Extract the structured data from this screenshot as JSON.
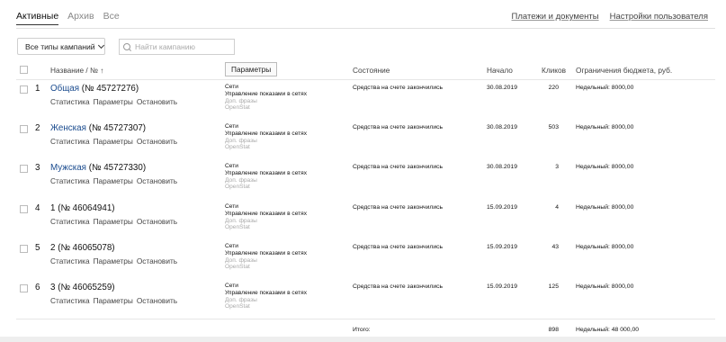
{
  "tabs": [
    {
      "label": "Активные",
      "active": true
    },
    {
      "label": "Архив",
      "active": false
    },
    {
      "label": "Все",
      "active": false
    }
  ],
  "top_links": {
    "payments": "Платежи и документы",
    "settings": "Настройки пользователя"
  },
  "filter": {
    "campaign_type": "Все типы кампаний",
    "search_placeholder": "Найти кампанию"
  },
  "columns": {
    "name": "Название / № ↑",
    "params_button": "Параметры",
    "state": "Состояние",
    "start": "Начало",
    "clicks": "Кликов",
    "budget": "Ограничения бюджета, руб."
  },
  "row_actions": {
    "stats": "Статистика",
    "params": "Параметры",
    "stop": "Остановить"
  },
  "campaign_params": {
    "line1": "Сети",
    "line2": "Управление показами в сетях",
    "line3": "Доп. фразы",
    "line4": "OpenStat"
  },
  "campaigns": [
    {
      "num": "1",
      "name": "Общая",
      "id": "(№ 45727276)",
      "state": "Средства на счете закончились",
      "start": "30.08.2019",
      "clicks": "220",
      "budget": "Недельный: 8000,00"
    },
    {
      "num": "2",
      "name": "Женская",
      "id": "(№ 45727307)",
      "state": "Средства на счете закончились",
      "start": "30.08.2019",
      "clicks": "503",
      "budget": "Недельный: 8000,00"
    },
    {
      "num": "3",
      "name": "Мужская",
      "id": "(№ 45727330)",
      "state": "Средства на счете закончились",
      "start": "30.08.2019",
      "clicks": "3",
      "budget": "Недельный: 8000,00"
    },
    {
      "num": "4",
      "name": "1",
      "id": "(№ 46064941)",
      "state": "Средства на счете закончились",
      "start": "15.09.2019",
      "clicks": "4",
      "budget": "Недельный: 8000,00"
    },
    {
      "num": "5",
      "name": "2",
      "id": "(№ 46065078)",
      "state": "Средства на счете закончились",
      "start": "15.09.2019",
      "clicks": "43",
      "budget": "Недельный: 8000,00"
    },
    {
      "num": "6",
      "name": "3",
      "id": "(№ 46065259)",
      "state": "Средства на счете закончились",
      "start": "15.09.2019",
      "clicks": "125",
      "budget": "Недельный: 8000,00"
    }
  ],
  "totals": {
    "label": "Итого:",
    "clicks": "898",
    "budget": "Недельный: 48 000,00"
  },
  "colors": {
    "link": "#1a4b8e",
    "muted": "#aaaaaa"
  }
}
